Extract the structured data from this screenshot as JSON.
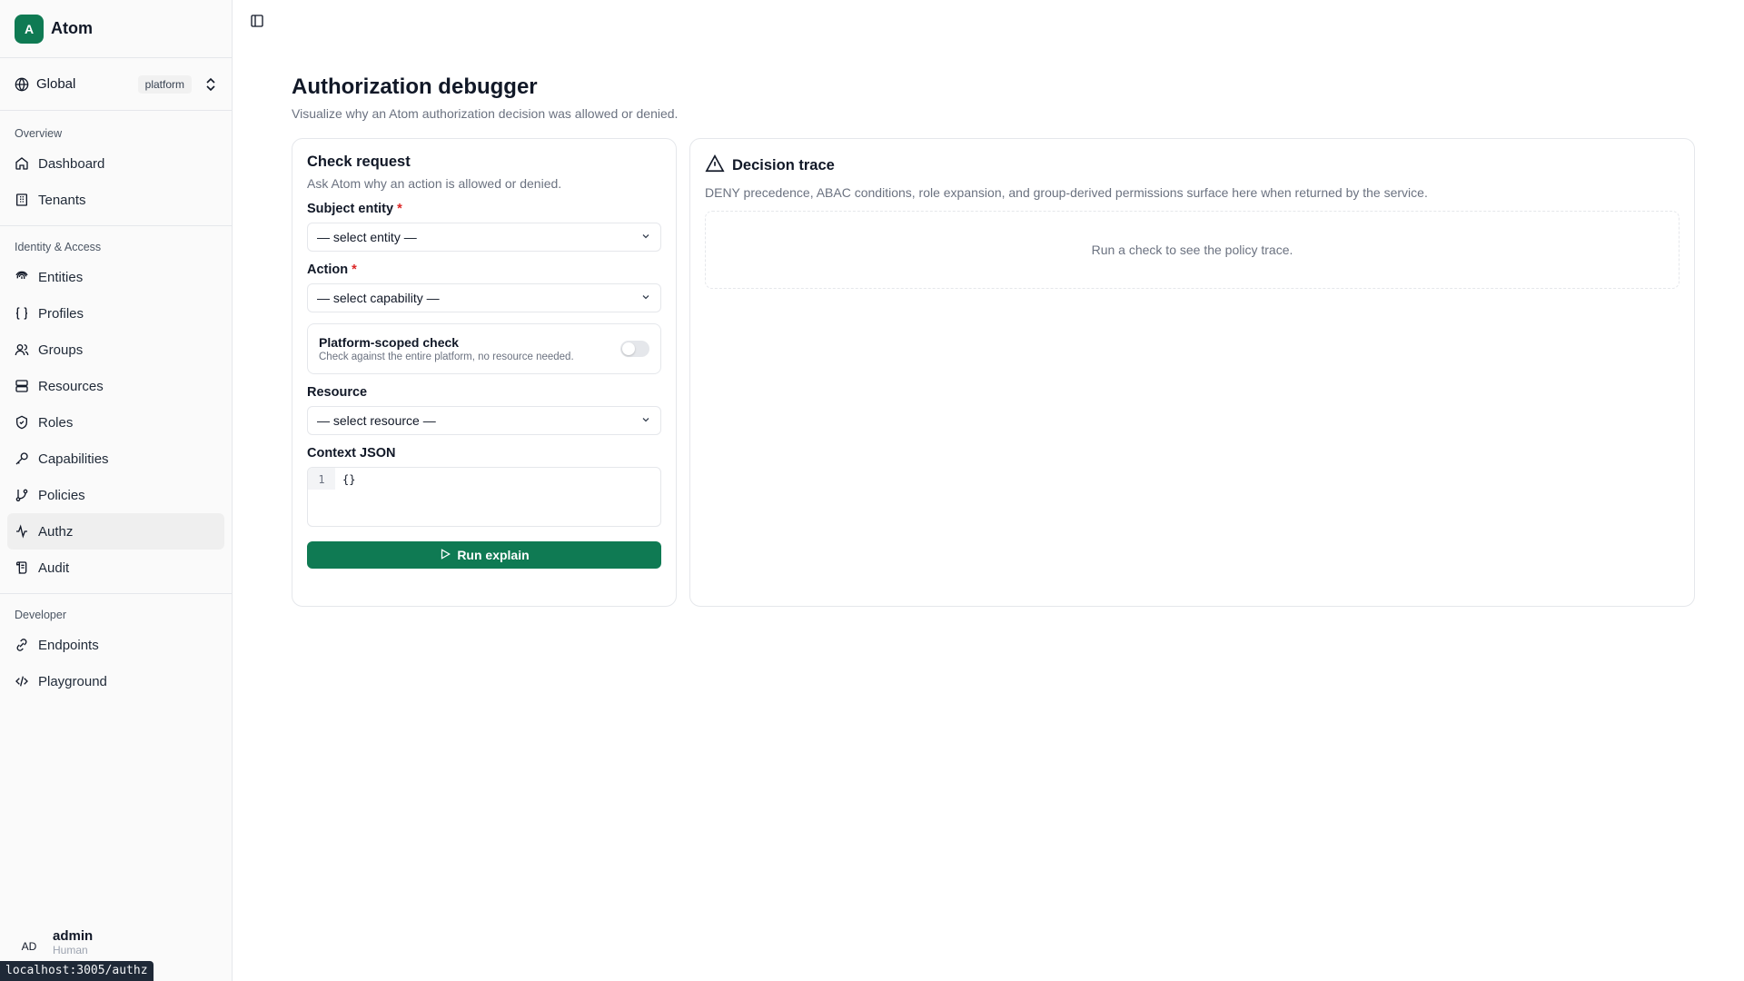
{
  "app": {
    "logo_letter": "A",
    "name": "Atom"
  },
  "scope": {
    "label": "Global",
    "tag": "platform"
  },
  "sidebar": {
    "groups": [
      {
        "title": "Overview",
        "items": [
          {
            "label": "Dashboard",
            "icon": "home-icon"
          },
          {
            "label": "Tenants",
            "icon": "building-icon"
          }
        ]
      },
      {
        "title": "Identity & Access",
        "items": [
          {
            "label": "Entities",
            "icon": "fingerprint-icon"
          },
          {
            "label": "Profiles",
            "icon": "braces-icon"
          },
          {
            "label": "Groups",
            "icon": "users-icon"
          },
          {
            "label": "Resources",
            "icon": "server-icon"
          },
          {
            "label": "Roles",
            "icon": "shield-icon"
          },
          {
            "label": "Capabilities",
            "icon": "key-icon"
          },
          {
            "label": "Policies",
            "icon": "git-branch-icon"
          },
          {
            "label": "Authz",
            "icon": "activity-icon",
            "active": true
          },
          {
            "label": "Audit",
            "icon": "scroll-icon"
          }
        ]
      },
      {
        "title": "Developer",
        "items": [
          {
            "label": "Endpoints",
            "icon": "link-icon"
          },
          {
            "label": "Playground",
            "icon": "code-icon"
          }
        ]
      }
    ]
  },
  "user": {
    "initials": "AD",
    "name": "admin",
    "role": "Human"
  },
  "status_url": "localhost:3005/authz",
  "page": {
    "title": "Authorization debugger",
    "subtitle": "Visualize why an Atom authorization decision was allowed or denied."
  },
  "check": {
    "title": "Check request",
    "description": "Ask Atom why an action is allowed or denied.",
    "subject_label": "Subject entity",
    "subject_value": "— select entity —",
    "action_label": "Action",
    "action_value": "— select capability —",
    "platform_title": "Platform-scoped check",
    "platform_desc": "Check against the entire platform, no resource needed.",
    "platform_enabled": false,
    "resource_label": "Resource",
    "resource_value": "— select resource —",
    "context_label": "Context JSON",
    "context_line_no": "1",
    "context_value": "{}",
    "run_label": "Run explain",
    "required_mark": "*"
  },
  "trace": {
    "title": "Decision trace",
    "description": "DENY precedence, ABAC conditions, role expansion, and group-derived permissions surface here when returned by the service.",
    "empty": "Run a check to see the policy trace."
  },
  "colors": {
    "accent": "#0f7a53",
    "required": "#dc2626"
  }
}
